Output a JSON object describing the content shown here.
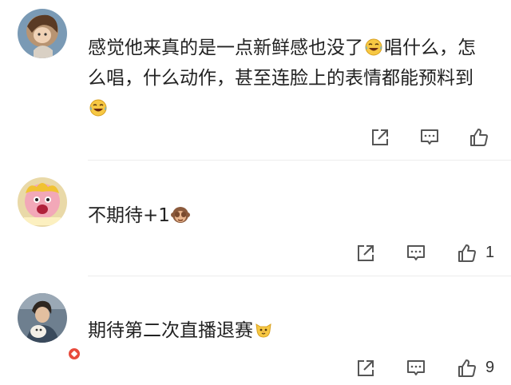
{
  "comments": [
    {
      "text_a": "感觉他来真的是一点新鲜感也没了",
      "text_b": "唱什么，怎么唱，什么动作，甚至连脸上的表情都能预料到",
      "emoji": "laughing-crying",
      "like_count": ""
    },
    {
      "text_a": "不期待+1",
      "emoji": "see-no-evil-monkey",
      "like_count": "1"
    },
    {
      "text_a": "期待第二次直播退赛",
      "emoji": "cat-face",
      "like_count": "9"
    }
  ],
  "colors": {
    "text": "#222222",
    "icon": "#555555",
    "divider": "#ececec",
    "badge": "#e84a3c"
  }
}
